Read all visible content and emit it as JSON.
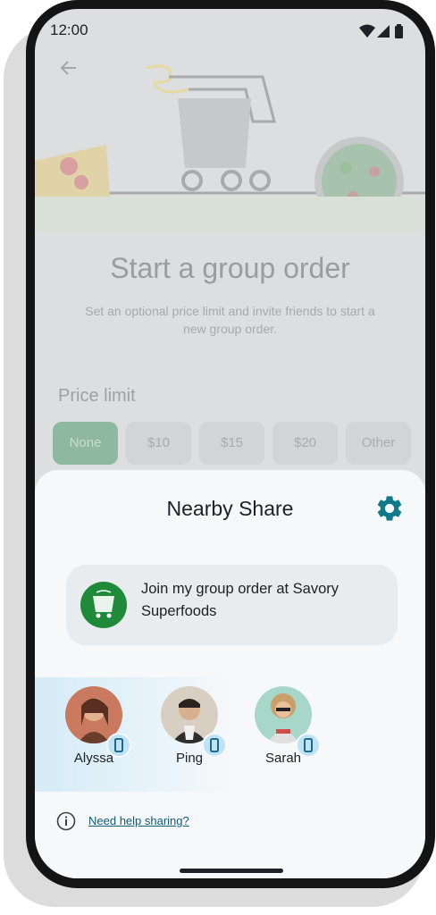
{
  "status_bar": {
    "time": "12:00"
  },
  "background_app": {
    "title": "Start a group order",
    "subtitle": "Set an optional price limit and invite friends to start a new group order.",
    "price_limit_label": "Price limit",
    "price_options": [
      "None",
      "$10",
      "$15",
      "$20",
      "Other"
    ],
    "selected_option": "None"
  },
  "share_sheet": {
    "title": "Nearby Share",
    "shared_item_text": "Join my group order at Savory Superfoods",
    "devices": [
      {
        "name": "Alyssa",
        "device_icon": "phone-icon"
      },
      {
        "name": "Ping",
        "device_icon": "phone-icon"
      },
      {
        "name": "Sarah",
        "device_icon": "phone-icon"
      }
    ],
    "help_link": "Need help sharing?"
  },
  "colors": {
    "accent": "#0f7a8a",
    "card_icon_green": "#1e8a3a",
    "selected_chip": "#8eb99e",
    "sheet_bg": "#f6f8fa",
    "scrim": "#dcdedf"
  }
}
